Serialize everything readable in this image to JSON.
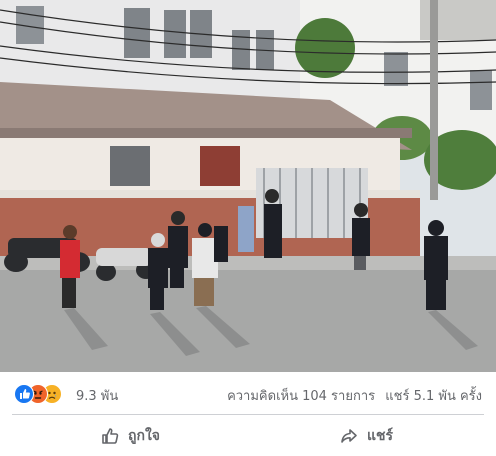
{
  "post": {
    "photo": {
      "kind": "street-scene-photo"
    },
    "reactions": {
      "icons": [
        "like-icon",
        "angry-icon",
        "sad-icon"
      ],
      "count": "9.3 พัน",
      "colors": {
        "like": "#1877f2",
        "angry": "#f0642a",
        "sad": "#f7b125"
      }
    },
    "stats": {
      "comments": "ความคิดเห็น 104 รายการ",
      "shares": "แชร์ 5.1 พัน ครั้ง"
    },
    "actions": {
      "like_label": "ถูกใจ",
      "share_label": "แชร์"
    }
  }
}
